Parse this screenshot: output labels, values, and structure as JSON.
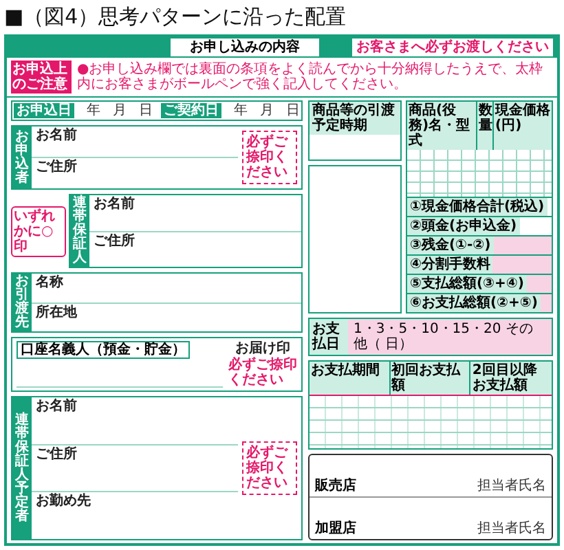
{
  "title": "■（図4）思考パターンに沿った配置",
  "form": {
    "header": "お申し込みの内容",
    "header_note": "お客さまへ必ずお渡しください",
    "notice": {
      "label": "お申込上のご注意",
      "text": "●お申し込み欄では裏面の条項をよく読んでから十分納得したうえで、太枠内にお客さまがボールペンで強く記入してください。"
    },
    "dates": [
      {
        "label": "お申込日",
        "parts": [
          "年",
          "月",
          "日"
        ]
      },
      {
        "label": "ご契約日",
        "parts": [
          "年",
          "月",
          "日"
        ]
      }
    ],
    "sections": [
      {
        "kind": "person",
        "label": "お申込者",
        "fields": [
          "お名前",
          "ご住所"
        ],
        "seal_note": "必ずご捺印ください"
      },
      {
        "kind": "choice",
        "note": "いずれかに○印"
      },
      {
        "kind": "person",
        "label": "連帯保証人",
        "fields": [
          "お名前",
          "ご住所"
        ]
      },
      {
        "kind": "place",
        "label": "お引渡先",
        "fields": [
          "名称",
          "所在地"
        ]
      },
      {
        "kind": "account",
        "title": "口座名義人（預金・貯金）",
        "seal_label": "お届け印",
        "seal_note": "必ずご捺印ください"
      },
      {
        "kind": "person",
        "label": "連帯保証人予定者",
        "fields": [
          "お名前",
          "ご住所",
          "お勤め先"
        ],
        "seal_note": "必ずご捺印ください"
      }
    ],
    "delivery_time": {
      "label": "商品等の引渡予定時期"
    },
    "price_table": {
      "columns": [
        "商品(役務)名・型式",
        "数量",
        "現金価格(円)"
      ],
      "summary": [
        {
          "label": "①現金価格合計(税込)",
          "highlight": false
        },
        {
          "label": "②頭金(お申込金)",
          "highlight": false
        },
        {
          "label": "③残金(①-②)",
          "highlight": true
        },
        {
          "label": "④分割手数料",
          "highlight": true
        },
        {
          "label": "⑤支払総額(③+④)",
          "highlight": true
        },
        {
          "label": "⑥お支払総額(②+⑤)",
          "highlight": true
        }
      ]
    },
    "pay_day": {
      "label": "お支払日",
      "value": "1・3・5・10・15・20 その他（ 日）"
    },
    "schedule": {
      "columns": [
        "お支払期間",
        "初回お支払額",
        "2回目以降お支払額"
      ]
    },
    "shops": [
      {
        "label": "販売店",
        "staff": "担当者氏名"
      },
      {
        "label": "加盟店",
        "staff": "担当者氏名"
      }
    ]
  }
}
